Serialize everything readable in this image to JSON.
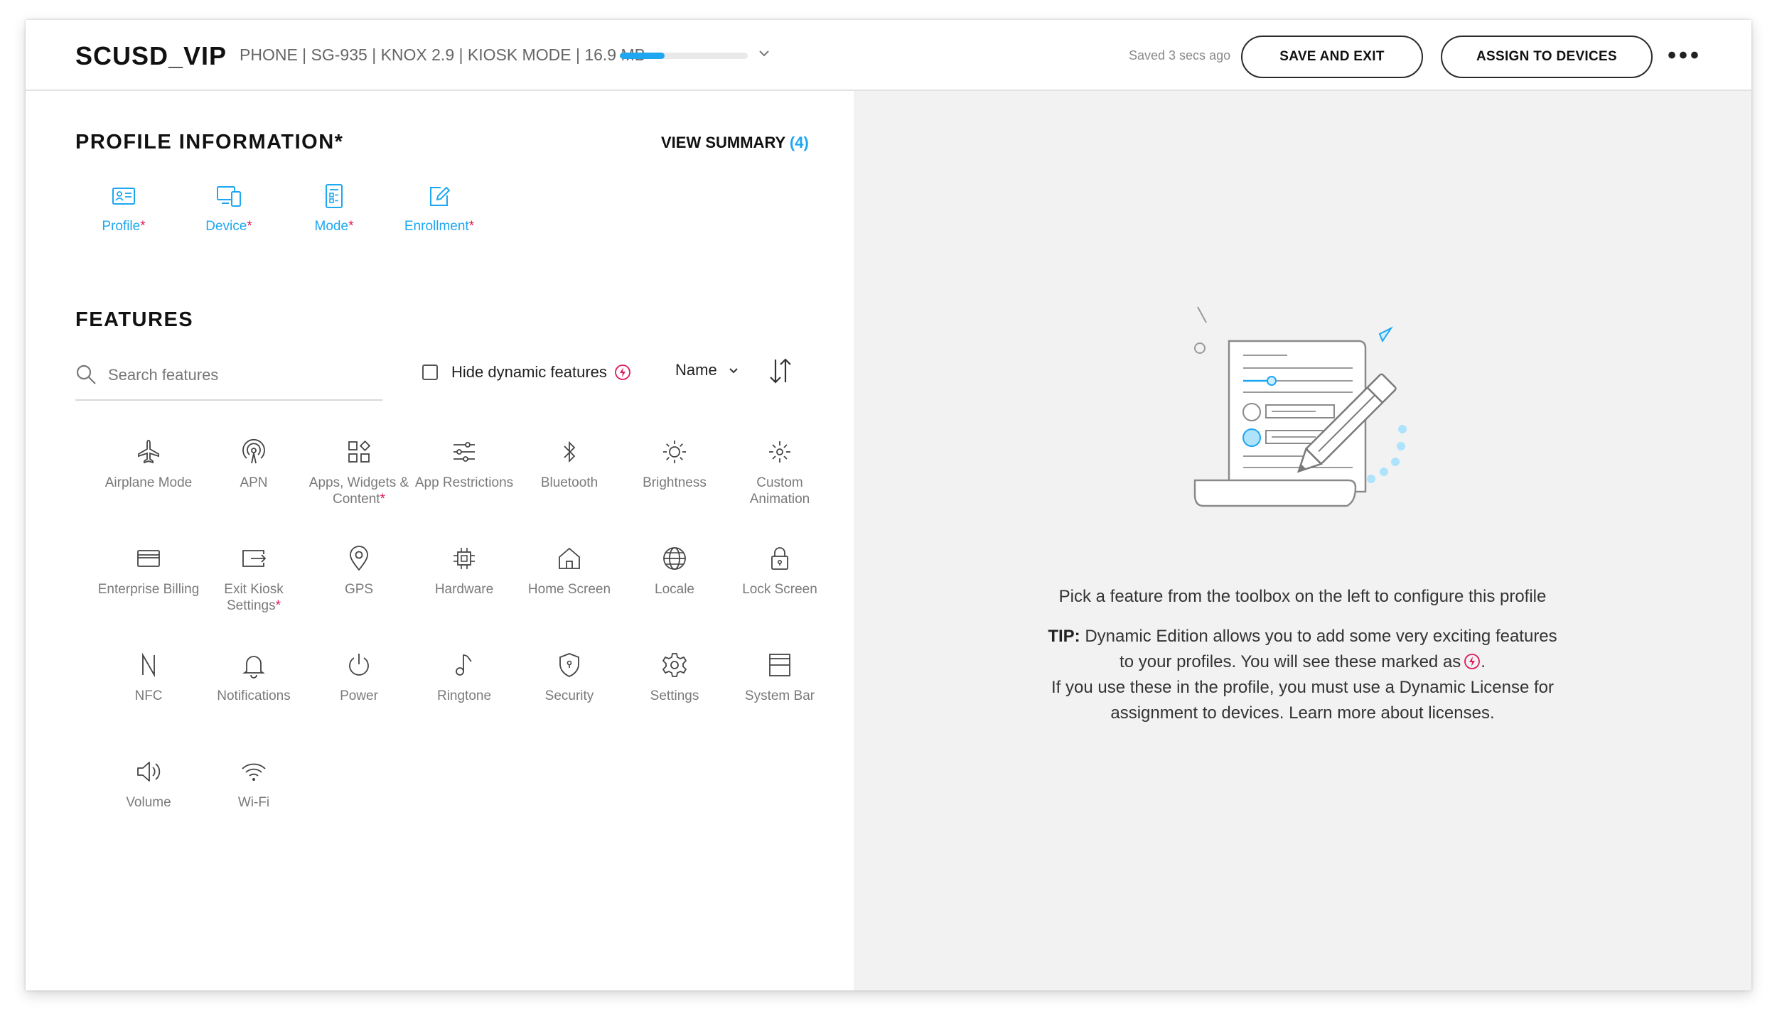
{
  "header": {
    "title": "SCUSD_VIP",
    "device_meta": "PHONE | SG-935 | KNOX 2.9 | KIOSK MODE | 16.9 MB",
    "progress_fraction": 0.35,
    "saved_status": "Saved 3 secs ago",
    "save_exit_label": "SAVE AND EXIT",
    "assign_label": "ASSIGN TO DEVICES",
    "more_label": "•••"
  },
  "profile_info": {
    "heading": "PROFILE INFORMATION*",
    "view_summary_label": "VIEW SUMMARY",
    "view_summary_count": "(4)",
    "tabs": [
      {
        "label": "Profile",
        "required": "*",
        "icon": "profile-card-icon"
      },
      {
        "label": "Device",
        "required": "*",
        "icon": "device-icon"
      },
      {
        "label": "Mode",
        "required": "*",
        "icon": "mode-icon"
      },
      {
        "label": "Enrollment",
        "required": "*",
        "icon": "enrollment-icon"
      }
    ]
  },
  "features": {
    "heading": "FEATURES",
    "search_placeholder": "Search features",
    "hide_dynamic_label": "Hide dynamic features",
    "sort_label": "Name",
    "items": [
      {
        "label": "Airplane Mode",
        "required": "",
        "icon": "airplane-icon"
      },
      {
        "label": "APN",
        "required": "",
        "icon": "apn-icon"
      },
      {
        "label": "Apps, Widgets & Content",
        "required": "*",
        "icon": "apps-icon"
      },
      {
        "label": "App Restrictions",
        "required": "",
        "icon": "sliders-icon"
      },
      {
        "label": "Bluetooth",
        "required": "",
        "icon": "bluetooth-icon"
      },
      {
        "label": "Brightness",
        "required": "",
        "icon": "brightness-icon"
      },
      {
        "label": "Custom Animation",
        "required": "",
        "icon": "animation-icon"
      },
      {
        "label": "Enterprise Billing",
        "required": "",
        "icon": "billing-card-icon"
      },
      {
        "label": "Exit Kiosk Settings",
        "required": "*",
        "icon": "exit-kiosk-icon"
      },
      {
        "label": "GPS",
        "required": "",
        "icon": "location-pin-icon"
      },
      {
        "label": "Hardware",
        "required": "",
        "icon": "chip-icon"
      },
      {
        "label": "Home Screen",
        "required": "",
        "icon": "home-icon"
      },
      {
        "label": "Locale",
        "required": "",
        "icon": "globe-icon"
      },
      {
        "label": "Lock Screen",
        "required": "",
        "icon": "lock-icon"
      },
      {
        "label": "NFC",
        "required": "",
        "icon": "nfc-icon"
      },
      {
        "label": "Notifications",
        "required": "",
        "icon": "bell-icon"
      },
      {
        "label": "Power",
        "required": "",
        "icon": "power-icon"
      },
      {
        "label": "Ringtone",
        "required": "",
        "icon": "music-note-icon"
      },
      {
        "label": "Security",
        "required": "",
        "icon": "shield-icon"
      },
      {
        "label": "Settings",
        "required": "",
        "icon": "gear-icon"
      },
      {
        "label": "System Bar",
        "required": "",
        "icon": "system-bar-icon"
      },
      {
        "label": "Volume",
        "required": "",
        "icon": "volume-icon"
      },
      {
        "label": "Wi-Fi",
        "required": "",
        "icon": "wifi-icon"
      }
    ]
  },
  "empty_state": {
    "illustration_icon": "document-pencil-illustration",
    "pick_text": "Pick a feature from the toolbox on the left to configure this profile",
    "tip_label": "TIP:",
    "tip_line1": "Dynamic Edition allows you to add some very exciting features",
    "tip_line2": "to your profiles. You will see these marked as",
    "tip_line2_end": ".",
    "tip_line3": "If you use these in the profile, you must use a Dynamic License for",
    "tip_line4": "assignment to devices. Learn more about licenses."
  },
  "colors": {
    "accent": "#1ea7f1",
    "required": "#e0195a",
    "dynamic_badge": "#e0195a",
    "right_panel_bg": "#f2f2f2"
  }
}
